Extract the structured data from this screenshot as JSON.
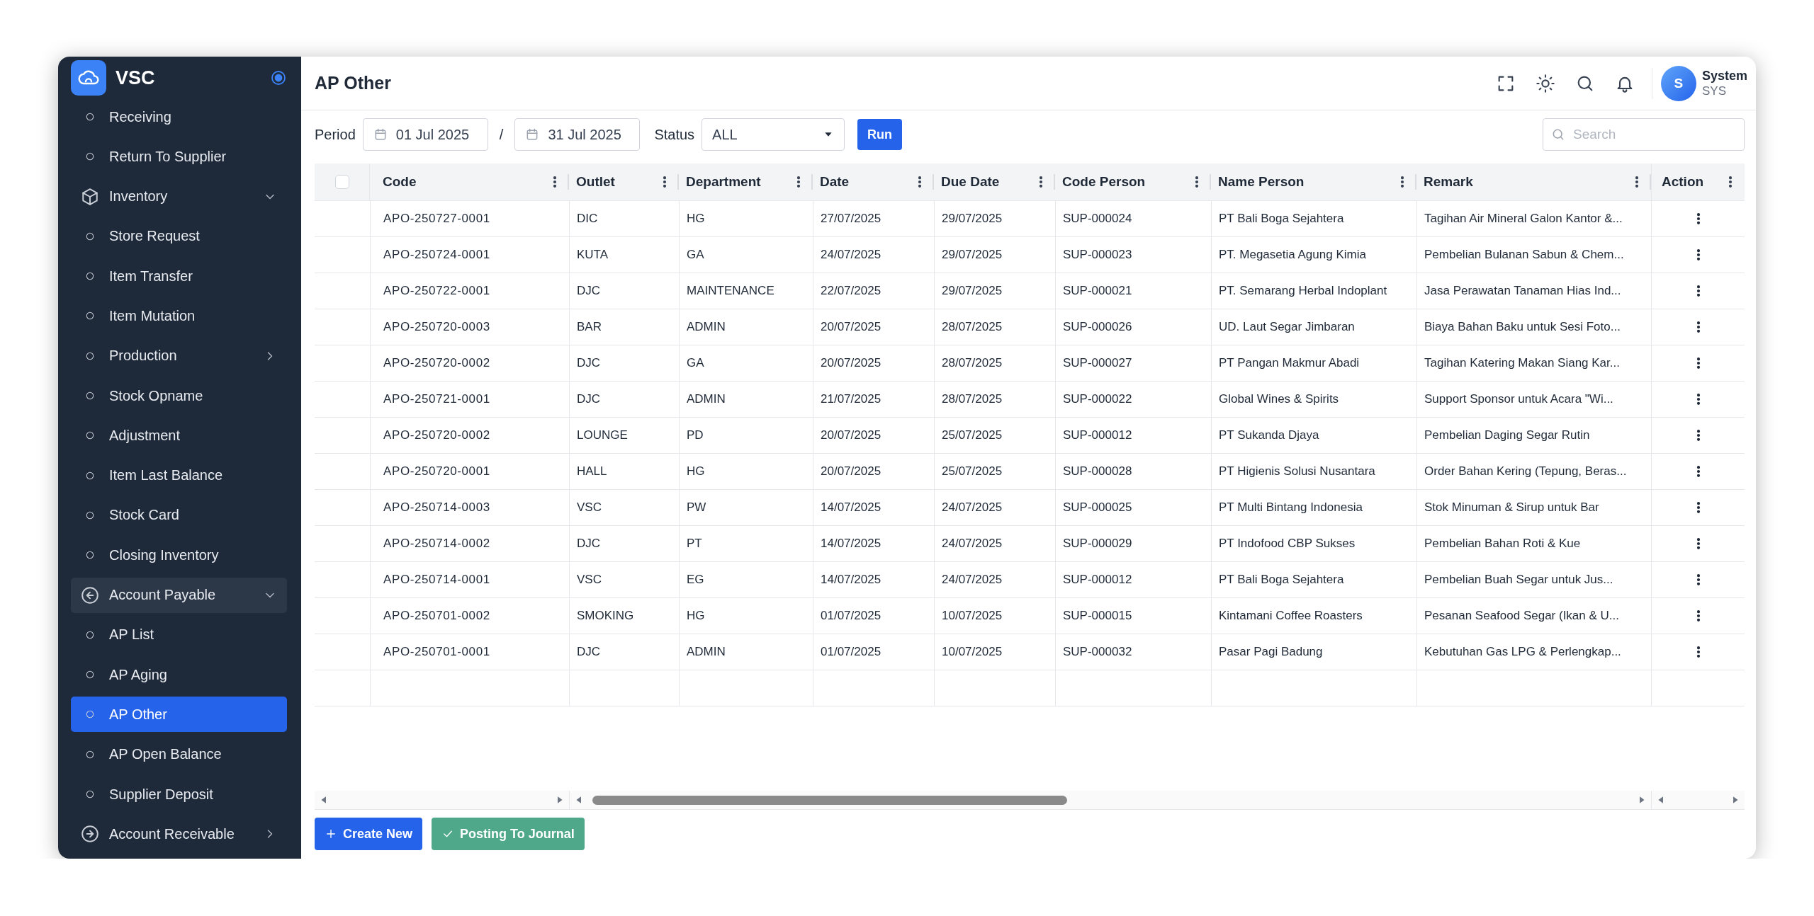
{
  "app": {
    "name": "VSC"
  },
  "sidebar": {
    "items": [
      {
        "label": "Receiving",
        "kind": "leaf",
        "selected": false
      },
      {
        "label": "Return To Supplier",
        "kind": "leaf",
        "selected": false
      },
      {
        "label": "Inventory",
        "kind": "group",
        "selected": false,
        "expanded": true,
        "children": [
          {
            "label": "Store Request",
            "kind": "leaf",
            "selected": false
          },
          {
            "label": "Item Transfer",
            "kind": "leaf",
            "selected": false
          },
          {
            "label": "Item Mutation",
            "kind": "leaf",
            "selected": false
          },
          {
            "label": "Production",
            "kind": "branch",
            "selected": false,
            "expanded": false
          },
          {
            "label": "Stock Opname",
            "kind": "leaf",
            "selected": false
          },
          {
            "label": "Adjustment",
            "kind": "leaf",
            "selected": false
          },
          {
            "label": "Item Last Balance",
            "kind": "leaf",
            "selected": false
          },
          {
            "label": "Stock Card",
            "kind": "leaf",
            "selected": false
          },
          {
            "label": "Closing Inventory",
            "kind": "leaf",
            "selected": false
          }
        ]
      },
      {
        "label": "Account Payable",
        "kind": "group",
        "selected": true,
        "expanded": true,
        "children": [
          {
            "label": "AP List",
            "kind": "leaf",
            "selected": false
          },
          {
            "label": "AP Aging",
            "kind": "leaf",
            "selected": false
          },
          {
            "label": "AP Other",
            "kind": "leaf",
            "selected": true
          },
          {
            "label": "AP Open Balance",
            "kind": "leaf",
            "selected": false
          },
          {
            "label": "Supplier Deposit",
            "kind": "leaf",
            "selected": false
          }
        ]
      },
      {
        "label": "Account Receivable",
        "kind": "group",
        "selected": false,
        "expanded": false
      }
    ]
  },
  "page": {
    "title": "AP Other"
  },
  "user": {
    "initial": "S",
    "name": "System",
    "role": "SYS"
  },
  "filters": {
    "period_label": "Period",
    "date_from": "01 Jul 2025",
    "separator": "/",
    "date_to": "31 Jul 2025",
    "status_label": "Status",
    "status": "ALL",
    "run_button": "Run",
    "search": {
      "placeholder": "Search"
    }
  },
  "table": {
    "select_all": {
      "checked": false
    },
    "columns": [
      "Code",
      "Outlet",
      "Department",
      "Date",
      "Due Date",
      "Code Person",
      "Name Person",
      "Remark",
      "Action"
    ],
    "rows": [
      {
        "cells": [
          "APO-250727-0001",
          "DIC",
          "HG",
          "27/07/2025",
          "29/07/2025",
          "SUP-000024",
          "PT Bali Boga Sejahtera",
          "Tagihan Air Mineral Galon Kantor &..."
        ]
      },
      {
        "cells": [
          "APO-250724-0001",
          "KUTA",
          "GA",
          "24/07/2025",
          "29/07/2025",
          "SUP-000023",
          "PT. Megasetia Agung Kimia",
          "Pembelian Bulanan Sabun & Chem..."
        ]
      },
      {
        "cells": [
          "APO-250722-0001",
          "DJC",
          "MAINTENANCE",
          "22/07/2025",
          "29/07/2025",
          "SUP-000021",
          "PT. Semarang Herbal Indoplant",
          "Jasa Perawatan Tanaman Hias Ind..."
        ]
      },
      {
        "cells": [
          "APO-250720-0003",
          "BAR",
          "ADMIN",
          "20/07/2025",
          "28/07/2025",
          "SUP-000026",
          "UD. Laut Segar Jimbaran",
          "Biaya Bahan Baku untuk Sesi Foto..."
        ]
      },
      {
        "cells": [
          "APO-250720-0002",
          "DJC",
          "GA",
          "20/07/2025",
          "28/07/2025",
          "SUP-000027",
          "PT Pangan Makmur Abadi",
          "Tagihan Katering Makan Siang Kar..."
        ]
      },
      {
        "cells": [
          "APO-250721-0001",
          "DJC",
          "ADMIN",
          "21/07/2025",
          "28/07/2025",
          "SUP-000022",
          "Global Wines & Spirits",
          "Support Sponsor untuk Acara \"Wi..."
        ]
      },
      {
        "cells": [
          "APO-250720-0002",
          "LOUNGE",
          "PD",
          "20/07/2025",
          "25/07/2025",
          "SUP-000012",
          "PT Sukanda Djaya",
          "Pembelian Daging Segar Rutin"
        ]
      },
      {
        "cells": [
          "APO-250720-0001",
          "HALL",
          "HG",
          "20/07/2025",
          "25/07/2025",
          "SUP-000028",
          "PT Higienis Solusi Nusantara",
          "Order Bahan Kering (Tepung, Beras..."
        ]
      },
      {
        "cells": [
          "APO-250714-0003",
          "VSC",
          "PW",
          "14/07/2025",
          "24/07/2025",
          "SUP-000025",
          "PT Multi Bintang Indonesia",
          "Stok Minuman & Sirup untuk Bar"
        ]
      },
      {
        "cells": [
          "APO-250714-0002",
          "DJC",
          "PT",
          "14/07/2025",
          "24/07/2025",
          "SUP-000029",
          "PT Indofood CBP Sukses",
          "Pembelian Bahan Roti & Kue"
        ]
      },
      {
        "cells": [
          "APO-250714-0001",
          "VSC",
          "EG",
          "14/07/2025",
          "24/07/2025",
          "SUP-000012",
          "PT Bali Boga Sejahtera",
          "Pembelian Buah Segar untuk Jus..."
        ]
      },
      {
        "cells": [
          "APO-250701-0002",
          "SMOKING",
          "HG",
          "01/07/2025",
          "10/07/2025",
          "SUP-000015",
          "Kintamani Coffee Roasters",
          "Pesanan Seafood Segar (Ikan & U..."
        ]
      },
      {
        "cells": [
          "APO-250701-0001",
          "DJC",
          "ADMIN",
          "01/07/2025",
          "10/07/2025",
          "SUP-000032",
          "Pasar Pagi Badung",
          "Kebutuhan Gas LPG & Perlengkap..."
        ]
      }
    ]
  },
  "buttons": [
    {
      "label": "Create New",
      "kind": "create"
    },
    {
      "label": "Posting To Journal",
      "kind": "post"
    }
  ]
}
